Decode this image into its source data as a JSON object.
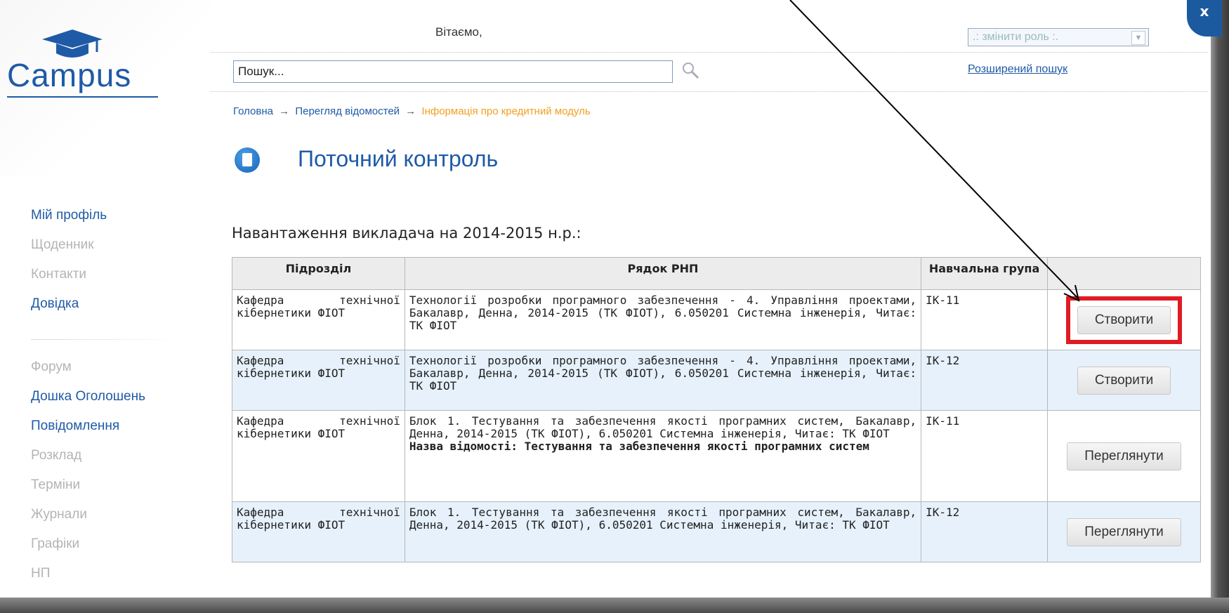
{
  "logo": {
    "text": "Campus"
  },
  "header": {
    "welcome": "Вітаємо,",
    "role_select": ".: змінити роль :.",
    "search_placeholder": "Пошук...",
    "advanced_search": "Розширений пошук",
    "close": "x"
  },
  "breadcrumb": {
    "items": [
      "Головна",
      "Перегляд відомостей"
    ],
    "separator": "→",
    "current": "Інформація про кредитний модуль"
  },
  "page": {
    "title": "Поточний контроль",
    "title_icon": "document-icon",
    "load_heading": "Навантаження викладача на 2014-2015 н.р.:"
  },
  "sidebar": {
    "items": [
      {
        "label": "Мій профіль",
        "active": true
      },
      {
        "label": "Щоденник",
        "active": false
      },
      {
        "label": "Контакти",
        "active": false
      },
      {
        "label": "Довідка",
        "active": true
      },
      {
        "label": "Форум",
        "active": false
      },
      {
        "label": "Дошка Оголошень",
        "active": true
      },
      {
        "label": "Повідомлення",
        "active": true
      },
      {
        "label": "Розклад",
        "active": false
      },
      {
        "label": "Терміни",
        "active": false
      },
      {
        "label": "Журнали",
        "active": false
      },
      {
        "label": "Графіки",
        "active": false
      },
      {
        "label": "НП",
        "active": false
      }
    ]
  },
  "table": {
    "headers": [
      "Підрозділ",
      "Рядок РНП",
      "Навчальна група",
      ""
    ],
    "rows": [
      {
        "dept": "Кафедра технічної кібернетики ФІОТ",
        "rnp": "Технології розробки програмного забезпечення - 4. Управління проектами, Бакалавр, Денна, 2014-2015 (ТК ФІОТ), 6.050201 Системна інженерія, Читає: ТК ФІОТ",
        "rnp_bold": "",
        "group": "ІК-11",
        "action": "Створити",
        "highlighted": true
      },
      {
        "dept": "Кафедра технічної кібернетики ФІОТ",
        "rnp": "Технології розробки програмного забезпечення - 4. Управління проектами, Бакалавр, Денна, 2014-2015 (ТК ФІОТ), 6.050201 Системна інженерія, Читає: ТК ФІОТ",
        "rnp_bold": "",
        "group": "ІК-12",
        "action": "Створити",
        "highlighted": false
      },
      {
        "dept": "Кафедра технічної кібернетики ФІОТ",
        "rnp": "Блок 1. Тестування та забезпечення якості програмних систем, Бакалавр, Денна, 2014-2015 (ТК ФІОТ), 6.050201 Системна інженерія, Читає: ТК ФІОТ",
        "rnp_bold": "Назва відомості: Тестування та забезпечення якості програмних систем",
        "group": "ІК-11",
        "action": "Переглянути",
        "highlighted": false
      },
      {
        "dept": "Кафедра технічної кібернетики ФІОТ",
        "rnp": "Блок 1. Тестування та забезпечення якості програмних систем, Бакалавр, Денна, 2014-2015 (ТК ФІОТ), 6.050201 Системна інженерія, Читає: ТК ФІОТ",
        "rnp_bold": "",
        "group": "ІК-12",
        "action": "Переглянути",
        "highlighted": false
      }
    ]
  },
  "colors": {
    "brand": "#1f5aa6",
    "breadcrumb_current": "#f0a020",
    "highlight": "#e01b24",
    "row_alt": "#e6f1fb"
  }
}
